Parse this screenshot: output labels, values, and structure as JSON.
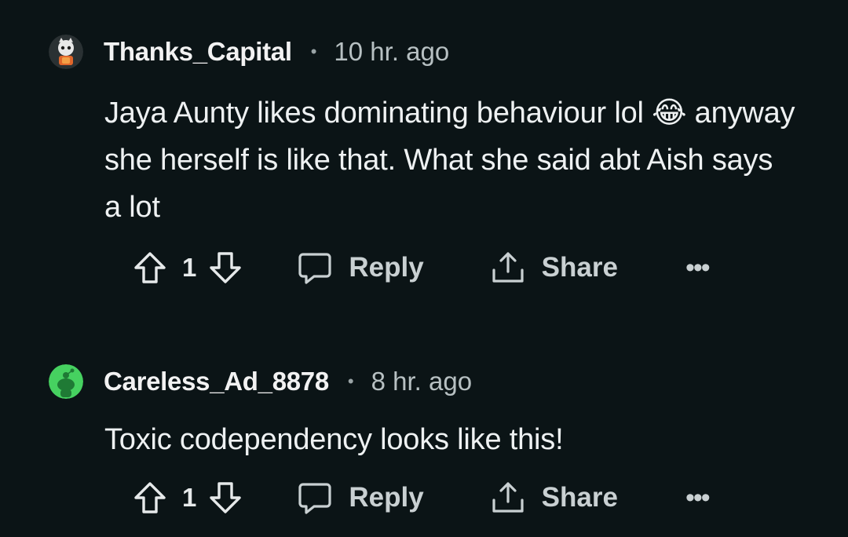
{
  "comments": [
    {
      "username": "Thanks_Capital",
      "separator": "•",
      "time": "10 hr. ago",
      "body": "Jaya Aunty likes dominating behaviour lol 😂 anyway she herself is like that. What she said abt Aish says a lot",
      "score": "1",
      "reply_label": "Reply",
      "share_label": "Share",
      "more_label": "•••",
      "avatar_icon": "snoo-avatar-costume"
    },
    {
      "username": "Careless_Ad_8878",
      "separator": "•",
      "time": "8 hr. ago",
      "body": "Toxic codependency looks like this!",
      "score": "1",
      "reply_label": "Reply",
      "share_label": "Share",
      "more_label": "•••",
      "avatar_icon": "default-snoo-avatar-green"
    }
  ],
  "colors": {
    "background": "#0b1416",
    "text": "#eef1f2",
    "muted": "#b7c0c2",
    "avatar_green": "#46d160"
  }
}
